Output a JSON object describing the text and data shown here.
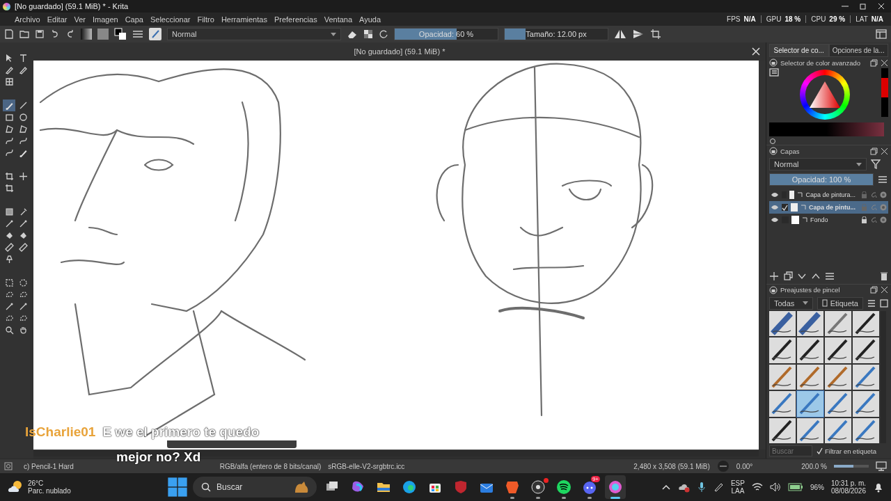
{
  "title_bar": {
    "title": "[No guardado]  (59.1 MiB) * - Krita"
  },
  "menu": [
    "Archivo",
    "Editar",
    "Ver",
    "Imagen",
    "Capa",
    "Seleccionar",
    "Filtro",
    "Herramientas",
    "Preferencias",
    "Ventana",
    "Ayuda"
  ],
  "stats": [
    {
      "label": "FPS",
      "value": "N/A"
    },
    {
      "label": "GPU",
      "value": "18 %"
    },
    {
      "label": "CPU",
      "value": "29 %"
    },
    {
      "label": "LAT",
      "value": "N/A"
    }
  ],
  "toolbar": {
    "blend_mode": "Normal",
    "opacity": {
      "label": "Opacidad: 60 %",
      "level": 0.6
    },
    "size": {
      "label": "Tamaño: 12.00 px",
      "level": 0.2
    }
  },
  "tool_groups": [
    [
      {
        "kind": "arrow",
        "selected": false
      },
      {
        "kind": "text",
        "selected": false
      },
      {
        "kind": "pen",
        "selected": false
      },
      {
        "kind": "pen",
        "selected": false
      },
      {
        "kind": "grid",
        "selected": false
      }
    ],
    [
      {
        "kind": "brush",
        "selected": true
      },
      {
        "kind": "line",
        "selected": false
      },
      {
        "kind": "rect",
        "selected": false
      },
      {
        "kind": "ellipse",
        "selected": false
      },
      {
        "kind": "polygon",
        "selected": false
      },
      {
        "kind": "polygon",
        "selected": false
      },
      {
        "kind": "curve",
        "selected": false
      },
      {
        "kind": "curve",
        "selected": false
      },
      {
        "kind": "curve",
        "selected": false
      },
      {
        "kind": "brush",
        "selected": false
      }
    ],
    [
      {
        "kind": "crop",
        "selected": false
      },
      {
        "kind": "move",
        "selected": false
      },
      {
        "kind": "crop",
        "selected": false
      }
    ],
    [
      {
        "kind": "gradient",
        "selected": false
      },
      {
        "kind": "picker",
        "selected": false
      },
      {
        "kind": "wand",
        "selected": false
      },
      {
        "kind": "wand",
        "selected": false
      },
      {
        "kind": "fill",
        "selected": false
      },
      {
        "kind": "fill",
        "selected": false
      },
      {
        "kind": "ruler",
        "selected": false
      },
      {
        "kind": "ruler",
        "selected": false
      },
      {
        "kind": "pin",
        "selected": false
      }
    ],
    [
      {
        "kind": "select-rect",
        "selected": false
      },
      {
        "kind": "select-ellipse",
        "selected": false
      },
      {
        "kind": "lasso",
        "selected": false
      },
      {
        "kind": "lasso",
        "selected": false
      },
      {
        "kind": "wand",
        "selected": false
      },
      {
        "kind": "wand",
        "selected": false
      },
      {
        "kind": "lasso",
        "selected": false
      },
      {
        "kind": "lasso",
        "selected": false
      },
      {
        "kind": "zoom",
        "selected": false
      },
      {
        "kind": "hand",
        "selected": false
      }
    ]
  ],
  "document_tab": {
    "title": "[No guardado]  (59.1 MiB) *"
  },
  "chat_overlay": {
    "user": "IsCharlie01",
    "lines": [
      "E we el primero te quedo",
      "mejor no? Xd"
    ]
  },
  "dock_tabs": [
    {
      "label": "Selector de co...",
      "selected": true
    },
    {
      "label": "Opciones de la...",
      "selected": false
    }
  ],
  "color_panel": {
    "title": "Selector de color avanzado"
  },
  "layers_panel": {
    "title": "Capas",
    "blend_mode": "Normal",
    "opacity": {
      "label": "Opacidad: 100 %",
      "level": 1
    },
    "layers": [
      {
        "name": "Capa de pintura...",
        "kind": "paint",
        "visible": true,
        "checked": false,
        "selected": false,
        "locked": false
      },
      {
        "name": "Capa de pintu...",
        "kind": "paint",
        "visible": true,
        "checked": true,
        "selected": true,
        "locked": false
      },
      {
        "name": "Fondo",
        "kind": "background",
        "visible": true,
        "checked": false,
        "selected": false,
        "locked": true
      }
    ]
  },
  "brush_panel": {
    "title": "Preajustes de pincel",
    "filter": "Todas",
    "tag": "Etiqueta",
    "presets": [
      {
        "kind": "eraser",
        "selected": false
      },
      {
        "kind": "eraser",
        "selected": false
      },
      {
        "kind": "airbrush",
        "selected": false
      },
      {
        "kind": "pen",
        "selected": false
      },
      {
        "kind": "pen",
        "selected": false
      },
      {
        "kind": "pen",
        "selected": false
      },
      {
        "kind": "pen",
        "selected": false
      },
      {
        "kind": "pen",
        "selected": false
      },
      {
        "kind": "brush",
        "selected": false
      },
      {
        "kind": "brush",
        "selected": false
      },
      {
        "kind": "brush",
        "selected": false
      },
      {
        "kind": "pencil",
        "selected": false
      },
      {
        "kind": "pencil",
        "selected": false
      },
      {
        "kind": "pencil",
        "selected": true
      },
      {
        "kind": "pencil",
        "selected": false
      },
      {
        "kind": "pencil",
        "selected": false
      },
      {
        "kind": "pen",
        "selected": false
      },
      {
        "kind": "pencil",
        "selected": false
      },
      {
        "kind": "pencil",
        "selected": false
      },
      {
        "kind": "pencil",
        "selected": false
      }
    ],
    "search": {
      "placeholder": "Buscar"
    },
    "filter_checkbox": {
      "label": "Filtrar en etiqueta",
      "checked": true
    }
  },
  "status_bar": {
    "brush": "c) Pencil-1 Hard",
    "color_model": "RGB/alfa (entero de 8 bits/canal)",
    "profile": "sRGB-elle-V2-srgbtrc.icc",
    "dimensions": "2,480 x 3,508 (59.1 MiB)",
    "rotation": "0.00°",
    "zoom": "200.0 %",
    "zoom_slider": {
      "level": 0.55
    }
  },
  "taskbar": {
    "weather": {
      "temperature": "26°C",
      "condition": "Parc. nublado"
    },
    "search": {
      "placeholder": "Buscar"
    },
    "apps": [
      {
        "kind": "task-view",
        "running": false,
        "active": false
      },
      {
        "kind": "copilot",
        "running": false,
        "active": false
      },
      {
        "kind": "folder",
        "running": false,
        "active": false
      },
      {
        "kind": "edge",
        "running": false,
        "active": false
      },
      {
        "kind": "store",
        "running": false,
        "active": false
      },
      {
        "kind": "shield",
        "running": false,
        "active": false
      },
      {
        "kind": "mail",
        "running": false,
        "active": false
      },
      {
        "kind": "lion",
        "running": true,
        "active": false
      },
      {
        "kind": "record",
        "running": true,
        "active": false,
        "alert": true
      },
      {
        "kind": "music",
        "running": true,
        "active": false
      },
      {
        "kind": "chat",
        "running": true,
        "active": false,
        "badge": "9+"
      },
      {
        "kind": "krita",
        "running": true,
        "active": true
      }
    ],
    "tray": {
      "language": "ESP",
      "layout": "LAA",
      "battery": "96%",
      "time": "10:31 p. m.",
      "date": "08/08/2026"
    }
  }
}
